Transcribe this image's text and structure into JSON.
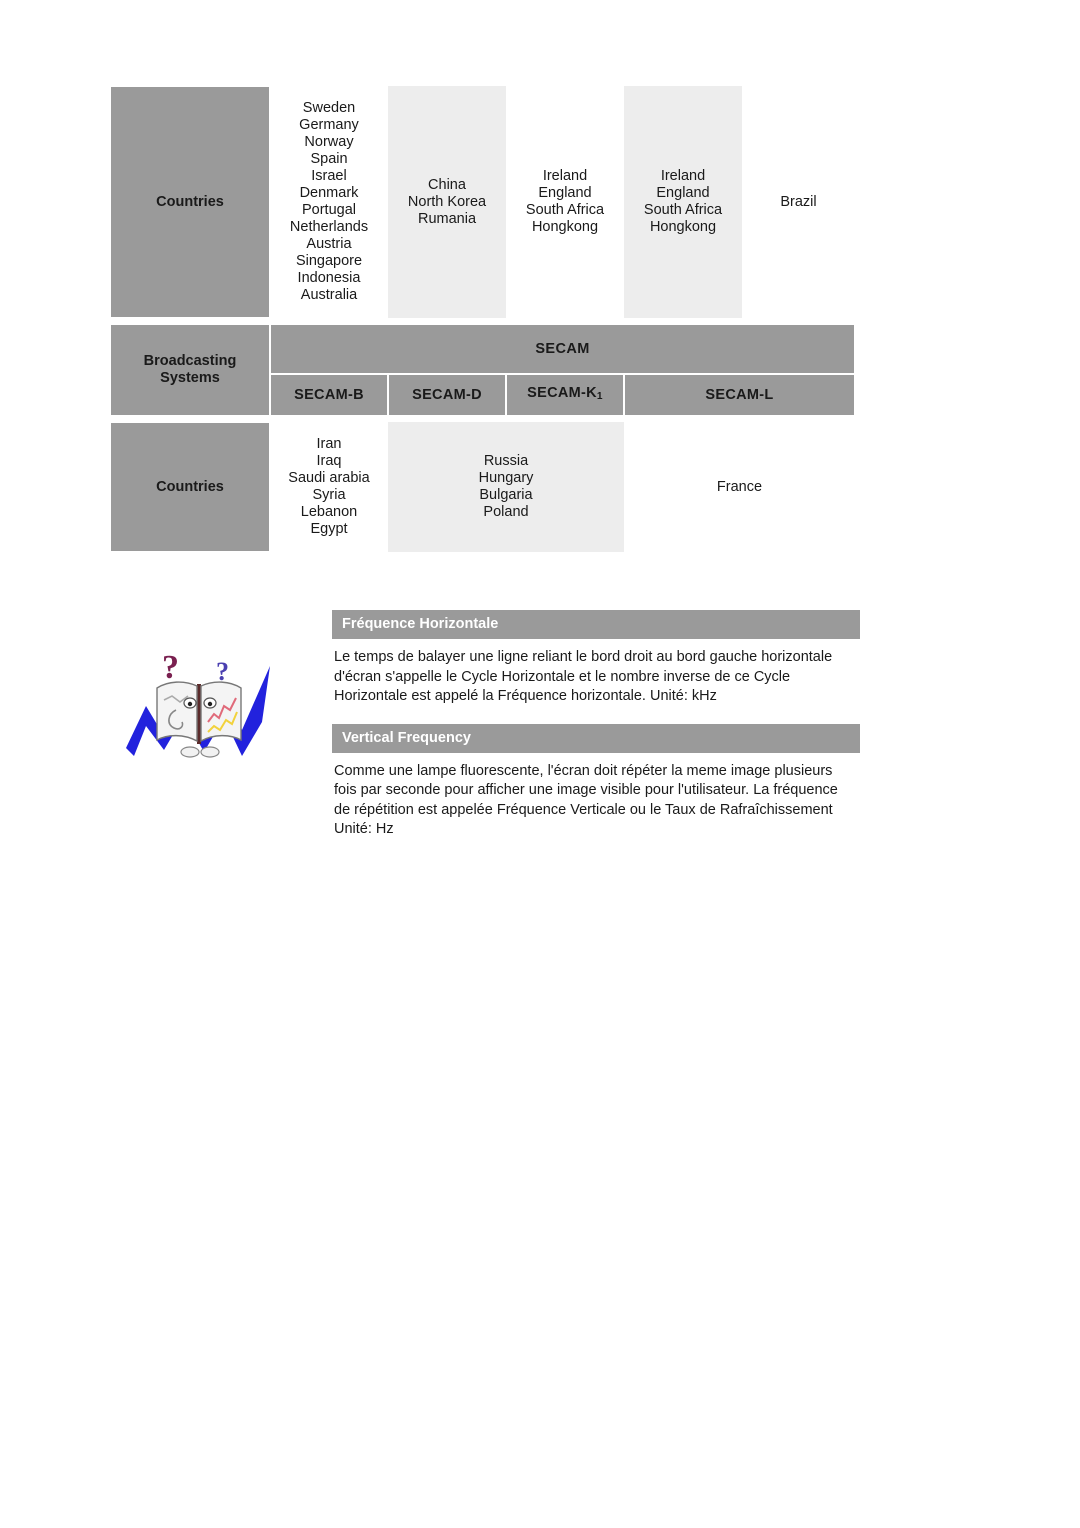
{
  "table": {
    "row1": {
      "label": "Countries",
      "cells": [
        {
          "style": "white",
          "lines": [
            "Sweden",
            "Germany",
            "Norway",
            "Spain",
            "Israel",
            "Denmark",
            "Portugal",
            "Netherlands",
            "Austria",
            "Singapore",
            "Indonesia",
            "Australia"
          ]
        },
        {
          "style": "gray",
          "lines": [
            "China",
            "North Korea",
            "Rumania"
          ]
        },
        {
          "style": "white",
          "lines": [
            "Ireland",
            "England",
            "South Africa",
            "Hongkong"
          ]
        },
        {
          "style": "gray",
          "lines": [
            "Ireland",
            "England",
            "South Africa",
            "Hongkong"
          ]
        },
        {
          "style": "white",
          "lines": [
            "Brazil"
          ]
        }
      ]
    },
    "row2": {
      "label_line1": "Broadcasting",
      "label_line2": "Systems",
      "band": "SECAM",
      "subsystems": [
        "SECAM-B",
        "SECAM-D",
        "SECAM-K",
        "SECAM-L"
      ],
      "k_subscript": "1"
    },
    "row3": {
      "label": "Countries",
      "cells": [
        {
          "style": "white",
          "span": 1,
          "lines": [
            "Iran",
            "Iraq",
            "Saudi arabia",
            "Syria",
            "Lebanon",
            "Egypt"
          ]
        },
        {
          "style": "gray",
          "span": 2,
          "lines": [
            "Russia",
            "Hungary",
            "Bulgaria",
            "Poland"
          ]
        },
        {
          "style": "white",
          "span": 1,
          "lines": [
            "France"
          ]
        }
      ]
    }
  },
  "sections": [
    {
      "title": "Fréquence Horizontale",
      "body": "Le temps de balayer une ligne reliant le bord droit au bord gauche horizontale d'écran s'appelle le Cycle Horizontale et le nombre inverse de ce Cycle Horizontale est appelé la Fréquence horizontale. Unité: kHz"
    },
    {
      "title": "Vertical Frequency",
      "body": "Comme une lampe fluorescente, l'écran doit répéter la meme image plusieurs fois par seconde pour afficher une image visible pour l'utilisateur. La fréquence de répétition est appelée Fréquence Verticale ou le Taux de Rafraîchissement Unité: Hz"
    }
  ],
  "illustration": {
    "name": "book-character-with-question-marks",
    "accent_color": "#2222dd",
    "question_mark_color": "#7a2050",
    "book_color": "#f2f2f2"
  },
  "colors": {
    "header_gray": "#9a9a9a",
    "cell_gray": "#ededed",
    "text": "#1a1a1a"
  }
}
